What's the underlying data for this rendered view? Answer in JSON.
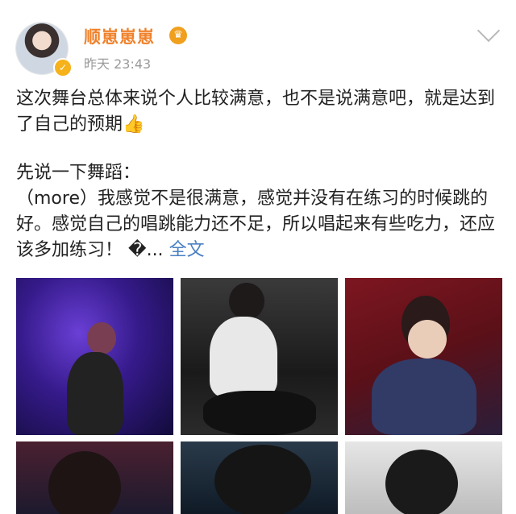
{
  "post": {
    "username": "顺崽崽崽",
    "crown_icon": "crown-icon",
    "verified_icon": "verified-badge-icon",
    "timestamp": "昨天 23:43",
    "paragraph1": "这次舞台总体来说个人比较满意，也不是说满意吧，就是达到了自己的预期",
    "paragraph1_emoji": "👍",
    "paragraph2_line1": "先说一下舞蹈：",
    "paragraph2_body": "（more）我感觉不是很满意，感觉并没有在练习的时候跳的好。感觉自己的唱跳能力还不足，所以唱起来有些吃力，还应该多加练习！",
    "truncation": "�...",
    "expand_label": "全文"
  },
  "photos": [
    {
      "name": "stage-performance-purple"
    },
    {
      "name": "drum-kit-stage"
    },
    {
      "name": "red-backdrop-portrait"
    },
    {
      "name": "in-ear-monitor-closeup"
    },
    {
      "name": "head-down-closeup"
    },
    {
      "name": "light-background-portrait"
    }
  ],
  "colors": {
    "username": "#f0812a",
    "link": "#4a7fc3",
    "timestamp": "#9a9a9a"
  }
}
